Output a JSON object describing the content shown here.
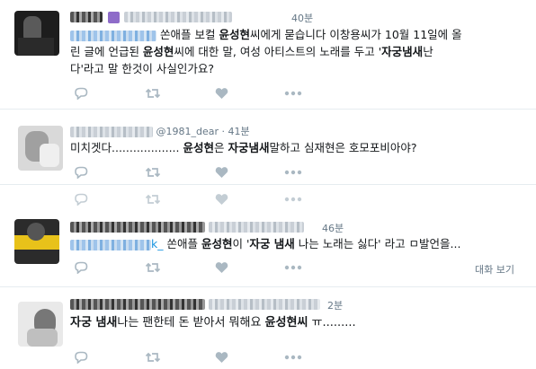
{
  "tweets": [
    {
      "time": "40분",
      "text": {
        "p1": "쏜애플 보컬 ",
        "b1": "윤성현",
        "p2": "씨에게 묻습니다 이창용씨가 10월 11일에 올",
        "line2_p1": "린 글에 언급된 ",
        "line2_b1": "윤성현",
        "line2_p2": "씨에 대한 말, 여성 아티스트의 노래를 두고 '",
        "line2_b2": "자궁냄새",
        "line2_p3": "난",
        "line3": "다'라고 말 한것이 사실인가요?"
      }
    },
    {
      "handle": "@1981_dear · 41분",
      "text": {
        "p1": "미치겟다................... ",
        "b1": "윤성현",
        "p2": "은 ",
        "b2": "자궁냄새",
        "p3": "말하고 심재현은 호모포비아야?"
      }
    },
    {
      "time": "46분",
      "text": {
        "handle_part": "k_",
        "p1": " 쏜애플 ",
        "b1": "윤성현",
        "p2": "이 '",
        "b2": "자궁 냄새",
        "p3": " 나는 노래는 싫다' 라고 ㅁ발언을..."
      },
      "thread_link": "대화 보기"
    },
    {
      "time": "2분",
      "text": {
        "b1": "자궁 냄새",
        "p1": "나는 팬한테 돈 받아서 뭐해요 ",
        "b2": "윤성현씨",
        "p2": " ㅠ........."
      }
    }
  ],
  "icons": [
    "reply-icon",
    "retweet-icon",
    "like-icon",
    "more-icon"
  ],
  "colors": {
    "meta": "#657786",
    "text": "#14171a",
    "divider": "#e6ecf0",
    "icon": "#aab8c2"
  }
}
